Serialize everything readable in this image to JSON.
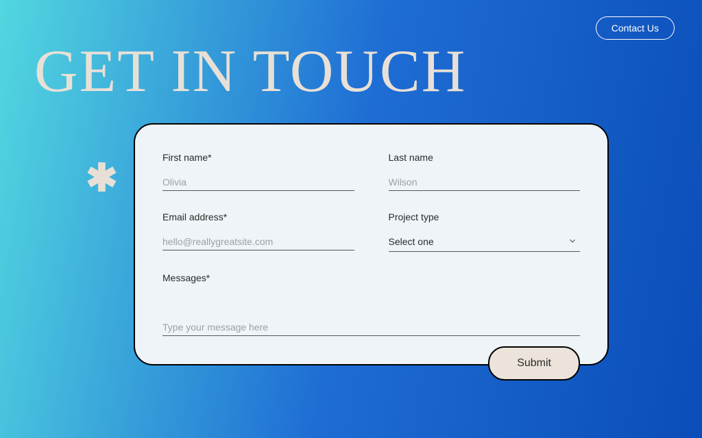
{
  "header": {
    "contact_us": "Contact Us"
  },
  "page_title": "GET IN TOUCH",
  "form": {
    "first_name": {
      "label": "First name*",
      "placeholder": "Olivia"
    },
    "last_name": {
      "label": "Last name",
      "placeholder": "Wilson"
    },
    "email": {
      "label": "Email address*",
      "placeholder": "hello@reallygreatsite.com"
    },
    "project_type": {
      "label": "Project type",
      "selected": "Select one"
    },
    "messages": {
      "label": "Messages*",
      "placeholder": "Type your message here"
    },
    "submit_label": "Submit"
  }
}
